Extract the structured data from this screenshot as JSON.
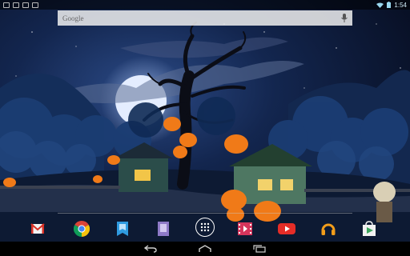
{
  "search": {
    "label": "Google"
  },
  "status": {
    "time": "1:54"
  },
  "dock_apps": [
    {
      "name": "gmail",
      "icon": "gmail-icon"
    },
    {
      "name": "chrome",
      "icon": "chrome-icon"
    },
    {
      "name": "play-books",
      "icon": "book-icon"
    },
    {
      "name": "play-magazines",
      "icon": "magazine-icon"
    },
    {
      "name": "all-apps",
      "icon": "apps-grid-icon"
    },
    {
      "name": "play-movies",
      "icon": "film-icon"
    },
    {
      "name": "youtube",
      "icon": "youtube-icon"
    },
    {
      "name": "play-music",
      "icon": "headphones-icon"
    },
    {
      "name": "play-store",
      "icon": "shopping-bag-icon"
    }
  ],
  "colors": {
    "sky": "#0c1833",
    "moon": "#dfe9ff",
    "pumpkin": "#f07a18",
    "status_icon": "#9ad8ef"
  }
}
